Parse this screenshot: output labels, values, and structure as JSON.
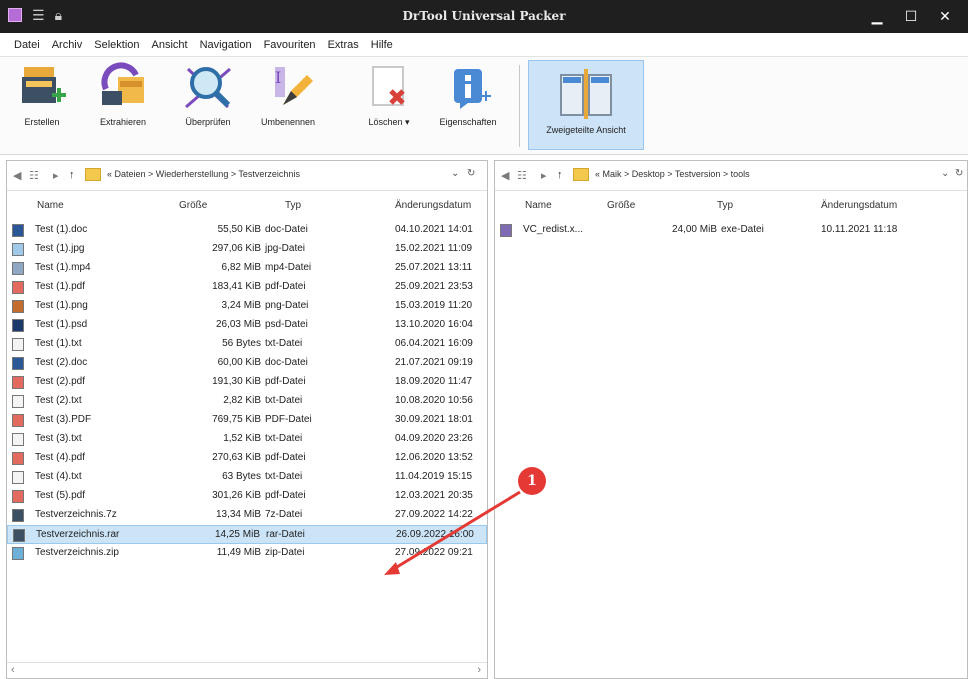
{
  "window": {
    "title": "DrTool Universal Packer"
  },
  "menu": [
    "Datei",
    "Archiv",
    "Selektion",
    "Ansicht",
    "Navigation",
    "Favouriten",
    "Extras",
    "Hilfe"
  ],
  "ribbon": [
    {
      "label": "Erstellen",
      "icon": "create-archive-icon"
    },
    {
      "label": "Extrahieren",
      "icon": "extract-icon"
    },
    {
      "label": "Überprüfen",
      "icon": "magnifier-icon"
    },
    {
      "label": "Umbenennen",
      "icon": "rename-pencil-icon"
    },
    {
      "label": "Löschen",
      "icon": "delete-icon"
    },
    {
      "label": "Eigenschaften",
      "icon": "info-icon"
    },
    {
      "label": "Zweigeteilte Ansicht",
      "icon": "split-view-icon"
    }
  ],
  "left_pane": {
    "breadcrumb": "« Dateien > Wiederherstellung > Testverzeichnis",
    "columns": [
      "Name",
      "Größe",
      "Typ",
      "Änderungsdatum"
    ],
    "files": [
      {
        "name": "Test (1).doc",
        "size": "55,50 KiB",
        "type": "doc-Datei",
        "date": "04.10.2021 14:01"
      },
      {
        "name": "Test (1).jpg",
        "size": "297,06 KiB",
        "type": "jpg-Datei",
        "date": "15.02.2021 11:09"
      },
      {
        "name": "Test (1).mp4",
        "size": "6,82 MiB",
        "type": "mp4-Datei",
        "date": "25.07.2021 13:11"
      },
      {
        "name": "Test (1).pdf",
        "size": "183,41 KiB",
        "type": "pdf-Datei",
        "date": "25.09.2021 23:53"
      },
      {
        "name": "Test (1).png",
        "size": "3,24 MiB",
        "type": "png-Datei",
        "date": "15.03.2019 11:20"
      },
      {
        "name": "Test (1).psd",
        "size": "26,03 MiB",
        "type": "psd-Datei",
        "date": "13.10.2020 16:04"
      },
      {
        "name": "Test (1).txt",
        "size": "56 Bytes",
        "type": "txt-Datei",
        "date": "06.04.2021 16:09"
      },
      {
        "name": "Test (2).doc",
        "size": "60,00 KiB",
        "type": "doc-Datei",
        "date": "21.07.2021 09:19"
      },
      {
        "name": "Test (2).pdf",
        "size": "191,30 KiB",
        "type": "pdf-Datei",
        "date": "18.09.2020 11:47"
      },
      {
        "name": "Test (2).txt",
        "size": "2,82 KiB",
        "type": "txt-Datei",
        "date": "10.08.2020 10:56"
      },
      {
        "name": "Test (3).PDF",
        "size": "769,75 KiB",
        "type": "PDF-Datei",
        "date": "30.09.2021 18:01"
      },
      {
        "name": "Test (3).txt",
        "size": "1,52 KiB",
        "type": "txt-Datei",
        "date": "04.09.2020 23:26"
      },
      {
        "name": "Test (4).pdf",
        "size": "270,63 KiB",
        "type": "pdf-Datei",
        "date": "12.06.2020 13:52"
      },
      {
        "name": "Test (4).txt",
        "size": "63 Bytes",
        "type": "txt-Datei",
        "date": "11.04.2019 15:15"
      },
      {
        "name": "Test (5).pdf",
        "size": "301,26 KiB",
        "type": "pdf-Datei",
        "date": "12.03.2021 20:35"
      },
      {
        "name": "Testverzeichnis.7z",
        "size": "13,34 MiB",
        "type": "7z-Datei",
        "date": "27.09.2022 14:22"
      },
      {
        "name": "Testverzeichnis.rar",
        "size": "14,25 MiB",
        "type": "rar-Datei",
        "date": "26.09.2022 16:00"
      },
      {
        "name": "Testverzeichnis.zip",
        "size": "11,49 MiB",
        "type": "zip-Datei",
        "date": "27.09.2022 09:21"
      }
    ]
  },
  "right_pane": {
    "breadcrumb": "« Maik > Desktop > Testversion > tools",
    "columns": [
      "Name",
      "Größe",
      "Typ",
      "Änderungsdatum"
    ],
    "files": [
      {
        "name": "VC_redist.x...",
        "size": "24,00 MiB",
        "type": "exe-Datei",
        "date": "10.11.2021 11:18"
      }
    ]
  },
  "annotation": {
    "label": "1",
    "color": "#e53935"
  }
}
